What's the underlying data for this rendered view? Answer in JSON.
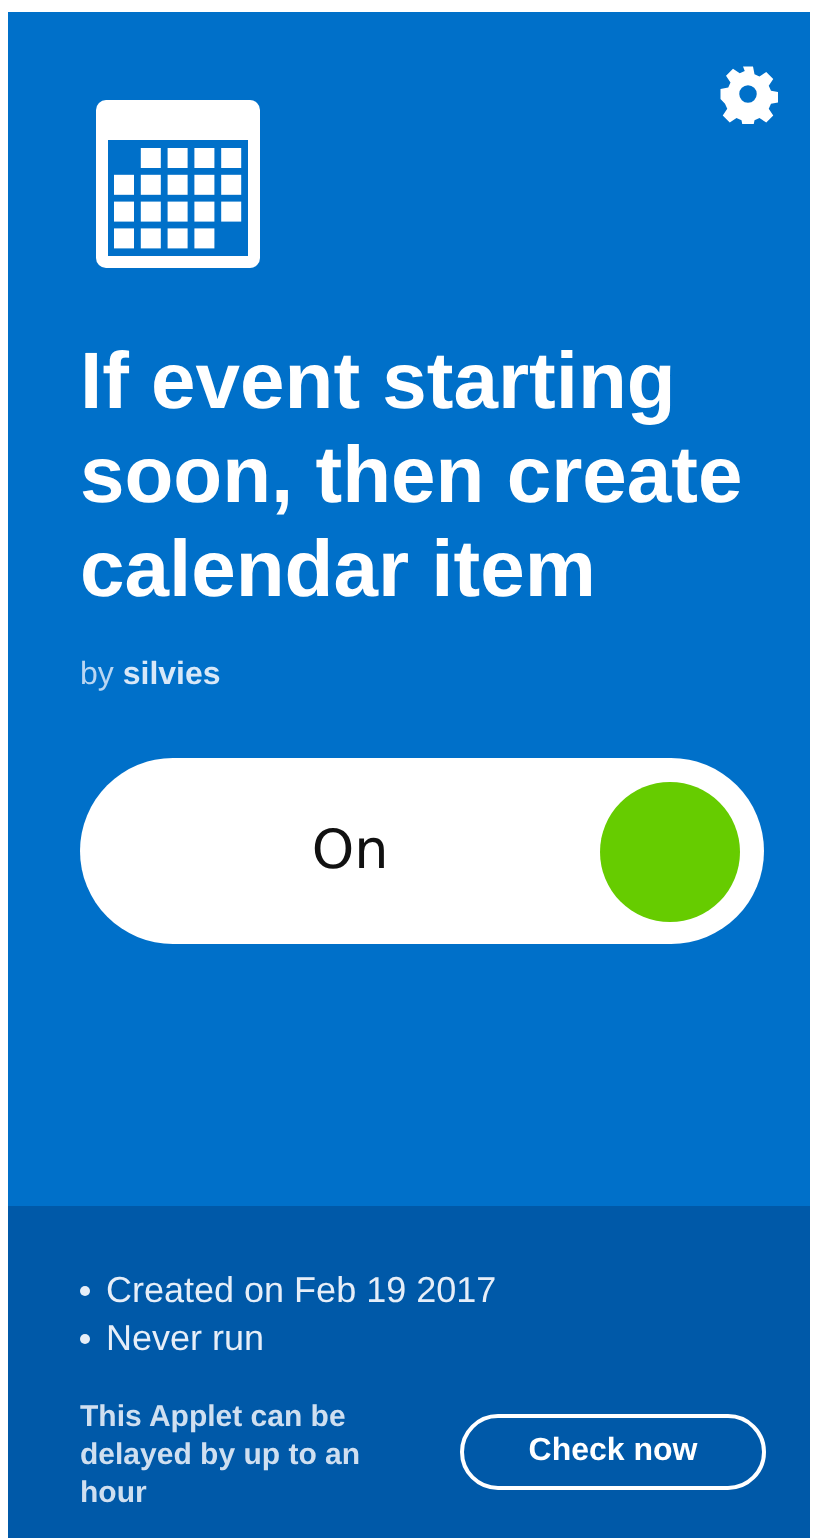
{
  "title": "If event starting soon, then create calendar item",
  "author": "by **silvies**",
  "toggle": {
    "label": "On",
    "on": true
  },
  "details": [
    "Created on Feb 19 2017",
    "Never run"
  ],
  "delay_note": "This Applet can be delayed by up to an hour",
  "check_button": "Check now"
}
